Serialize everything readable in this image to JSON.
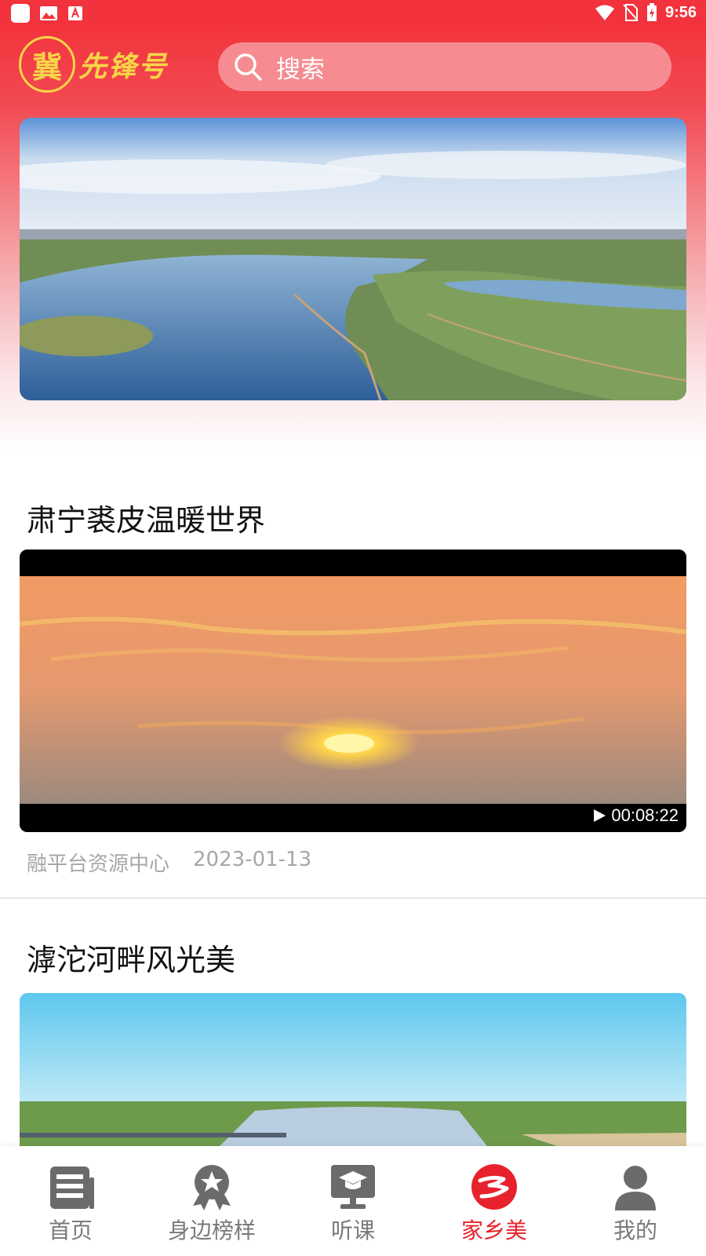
{
  "status_bar": {
    "time": "9:56"
  },
  "header": {
    "logo_seal_char": "冀",
    "logo_text": "先锋号",
    "search_placeholder": "搜索"
  },
  "feed": [
    {
      "title": "肃宁裘皮温暖世界",
      "duration": "00:08:22",
      "source": "融平台资源中心",
      "date": "2023-01-13"
    },
    {
      "title": "滹沱河畔风光美"
    }
  ],
  "tabbar": {
    "items": [
      {
        "label": "首页",
        "icon": "document-icon"
      },
      {
        "label": "身边榜样",
        "icon": "badge-star-icon"
      },
      {
        "label": "听课",
        "icon": "graduation-screen-icon"
      },
      {
        "label": "家乡美",
        "icon": "hometown-logo-icon",
        "active": true
      },
      {
        "label": "我的",
        "icon": "person-icon"
      }
    ]
  },
  "colors": {
    "brand_red": "#f2323c",
    "logo_gold": "#f7d548",
    "active_tab": "#e8222c",
    "inactive_tab": "#7a7a7a"
  }
}
